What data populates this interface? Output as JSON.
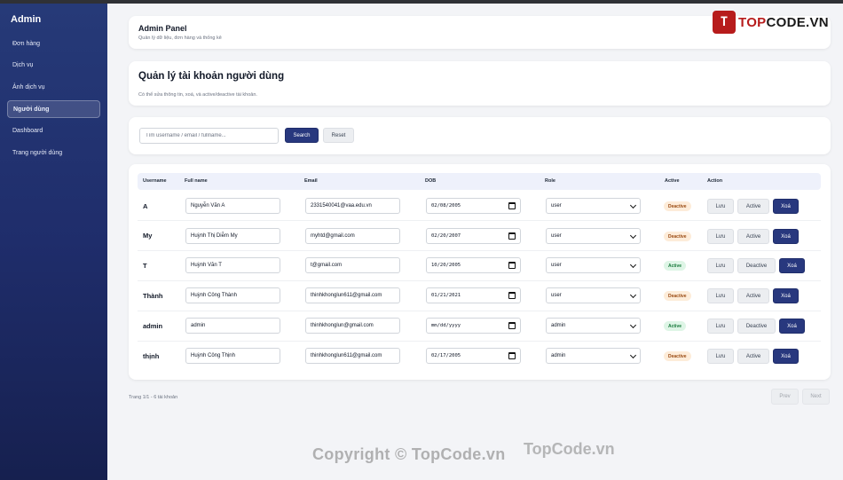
{
  "sidebar": {
    "brand": "Admin",
    "items": [
      {
        "label": "Đơn hàng",
        "active": false
      },
      {
        "label": "Dịch vụ",
        "active": false
      },
      {
        "label": "Ảnh dịch vụ",
        "active": false
      },
      {
        "label": "Người dùng",
        "active": true
      },
      {
        "label": "Dashboard",
        "active": false
      },
      {
        "label": "Trang người dùng",
        "active": false
      }
    ]
  },
  "header": {
    "title": "Admin Panel",
    "subtitle": "Quản lý dữ liệu, đơn hàng và thống kê"
  },
  "logo": {
    "mark": "T",
    "text_red": "TOP",
    "text_dark": "CODE.VN"
  },
  "page": {
    "title": "Quản lý tài khoản người dùng",
    "subtitle": "Có thể sửa thông tin, xoá, và active/deactive tài khoản."
  },
  "search": {
    "placeholder": "Tìm username / email / fullname...",
    "search_label": "Search",
    "reset_label": "Reset"
  },
  "table": {
    "headers": [
      "Username",
      "Full name",
      "Email",
      "DOB",
      "Role",
      "Active",
      "Action"
    ],
    "rows": [
      {
        "username": "A",
        "fullname": "Nguyễn Văn A",
        "email": "2331540041@vaa.edu.vn",
        "dob": "02/08/2005",
        "role": "user",
        "status": "Deactive",
        "toggle": "Active"
      },
      {
        "username": "My",
        "fullname": "Huỳnh Thị Diễm My",
        "email": "myhtd@gmail.com",
        "dob": "02/20/2007",
        "role": "user",
        "status": "Deactive",
        "toggle": "Active"
      },
      {
        "username": "T",
        "fullname": "Huỳnh Văn T",
        "email": "t@gmail.com",
        "dob": "10/20/2005",
        "role": "user",
        "status": "Active",
        "toggle": "Deactive"
      },
      {
        "username": "Thành",
        "fullname": "Huỳnh Công Thành",
        "email": "thinhkhonglun611@gmail.com",
        "dob": "01/21/2021",
        "role": "user",
        "status": "Deactive",
        "toggle": "Active"
      },
      {
        "username": "admin",
        "fullname": "admin",
        "email": "thinhkhonglun@gmail.com",
        "dob": "mm/dd/yyyy",
        "role": "admin",
        "status": "Active",
        "toggle": "Deactive"
      },
      {
        "username": "thịnh",
        "fullname": "Huỳnh Công Thịnh",
        "email": "thinhkhonglun611@gmail.com",
        "dob": "02/17/2005",
        "role": "admin",
        "status": "Deactive",
        "toggle": "Active"
      }
    ],
    "save_label": "Lưu",
    "delete_label": "Xoá"
  },
  "pagination": {
    "info": "Trang 1/1 - 6 tài khoản",
    "prev": "Prev",
    "next": "Next"
  },
  "watermarks": [
    "Copyright © TopCode.vn",
    "TopCode.vn"
  ],
  "colors": {
    "accent": "#28387e",
    "sidebar": "#1f2d6b",
    "logo_red": "#b71c1c"
  }
}
